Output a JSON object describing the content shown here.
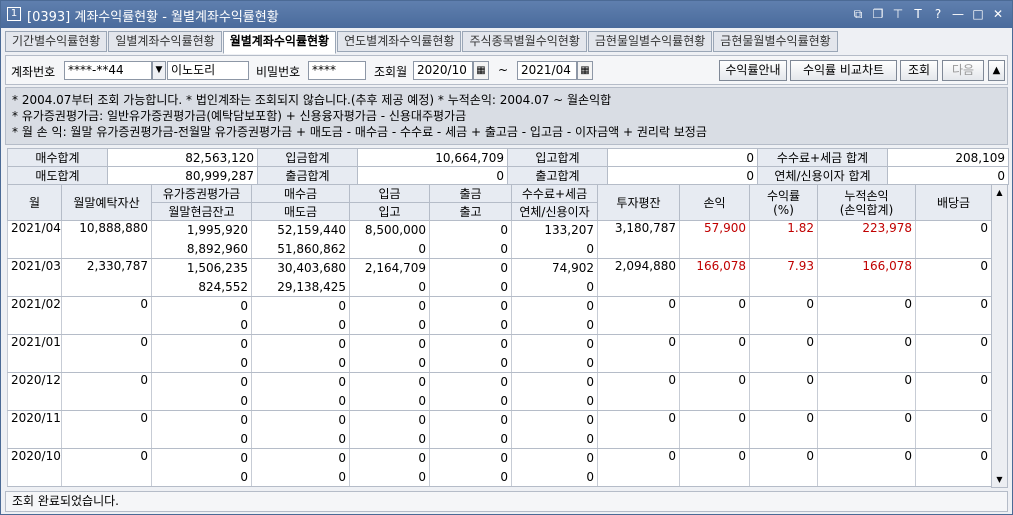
{
  "window": {
    "number": "1",
    "title": "[0393] 계좌수익률현황 - 월별계좌수익률현황"
  },
  "tabs": [
    "기간별수익률현황",
    "일별계좌수익률현황",
    "월별계좌수익률현황",
    "연도별계좌수익률현황",
    "주식종목별월수익현황",
    "금현물일별수익률현황",
    "금현물월별수익률현황"
  ],
  "toolbar": {
    "account_label": "계좌번호",
    "account_value": "****-**44",
    "account_name": "이노도리",
    "password_label": "비밀번호",
    "password_value": "****",
    "period_label": "조회월",
    "from": "2020/10",
    "tilde": "~",
    "to": "2021/04",
    "guide_btn": "수익률안내",
    "compare_btn": "수익률 비교차트",
    "query_btn": "조회",
    "next_btn": "다음",
    "up_btn": "▲"
  },
  "notes": [
    "* 2004.07부터 조회 가능합니다.   * 법인계좌는 조회되지 않습니다.(추후 제공 예정)   * 누적손익: 2004.07 ~ 월손익합",
    "* 유가증권평가금: 일반유가증권평가금(예탁담보포함) + 신용융자평가금 - 신용대주평가금",
    "* 월 손 익: 월말 유가증권평가금-전월말 유가증권평가금 + 매도금 - 매수금 - 수수료 - 세금 + 출고금 - 입고금 - 이자금액 + 권리락 보정금"
  ],
  "summary": {
    "buy_total_label": "매수합계",
    "buy_total": "82,563,120",
    "deposit_total_label": "입금합계",
    "deposit_total": "10,664,709",
    "in_total_label": "입고합계",
    "in_total": "0",
    "fee_total_label": "수수료+세금 합계",
    "fee_total": "208,109",
    "sell_total_label": "매도합계",
    "sell_total": "80,999,287",
    "withdraw_total_label": "출금합계",
    "withdraw_total": "0",
    "out_total_label": "출고합계",
    "out_total": "0",
    "interest_total_label": "연체/신용이자 합계",
    "interest_total": "0"
  },
  "grid": {
    "headers": {
      "month": "월",
      "deposit_assets": "월말예탁자산",
      "securities": "유가증권평가금",
      "cash_balance": "월말현금잔고",
      "buy": "매수금",
      "sell": "매도금",
      "deposit": "입금",
      "in": "입고",
      "withdraw": "출금",
      "out": "출고",
      "fee": "수수료+세금",
      "interest": "연체/신용이자",
      "investment": "투자평잔",
      "pnl": "손익",
      "rate": "수익률\n(%)",
      "cum": "누적손익\n(손익합계)",
      "dividend": "배당금"
    },
    "rows": [
      {
        "month": "2021/04",
        "assets": "10,888,880",
        "sec": "1,995,920",
        "cash": "8,892,960",
        "buy": "52,159,440",
        "sell": "51,860,862",
        "dep": "8,500,000",
        "in": "0",
        "wd": "0",
        "out": "0",
        "fee": "133,207",
        "int": "0",
        "inv": "3,180,787",
        "pnl": "57,900",
        "rate": "1.82",
        "cum": "223,978",
        "div": "0"
      },
      {
        "month": "2021/03",
        "assets": "2,330,787",
        "sec": "1,506,235",
        "cash": "824,552",
        "buy": "30,403,680",
        "sell": "29,138,425",
        "dep": "2,164,709",
        "in": "0",
        "wd": "0",
        "out": "0",
        "fee": "74,902",
        "int": "0",
        "inv": "2,094,880",
        "pnl": "166,078",
        "rate": "7.93",
        "cum": "166,078",
        "div": "0"
      },
      {
        "month": "2021/02",
        "assets": "0",
        "sec": "0",
        "cash": "0",
        "buy": "0",
        "sell": "0",
        "dep": "0",
        "in": "0",
        "wd": "0",
        "out": "0",
        "fee": "0",
        "int": "0",
        "inv": "0",
        "pnl": "0",
        "rate": "0",
        "cum": "0",
        "div": "0"
      },
      {
        "month": "2021/01",
        "assets": "0",
        "sec": "0",
        "cash": "0",
        "buy": "0",
        "sell": "0",
        "dep": "0",
        "in": "0",
        "wd": "0",
        "out": "0",
        "fee": "0",
        "int": "0",
        "inv": "0",
        "pnl": "0",
        "rate": "0",
        "cum": "0",
        "div": "0"
      },
      {
        "month": "2020/12",
        "assets": "0",
        "sec": "0",
        "cash": "0",
        "buy": "0",
        "sell": "0",
        "dep": "0",
        "in": "0",
        "wd": "0",
        "out": "0",
        "fee": "0",
        "int": "0",
        "inv": "0",
        "pnl": "0",
        "rate": "0",
        "cum": "0",
        "div": "0"
      },
      {
        "month": "2020/11",
        "assets": "0",
        "sec": "0",
        "cash": "0",
        "buy": "0",
        "sell": "0",
        "dep": "0",
        "in": "0",
        "wd": "0",
        "out": "0",
        "fee": "0",
        "int": "0",
        "inv": "0",
        "pnl": "0",
        "rate": "0",
        "cum": "0",
        "div": "0"
      },
      {
        "month": "2020/10",
        "assets": "0",
        "sec": "0",
        "cash": "0",
        "buy": "0",
        "sell": "0",
        "dep": "0",
        "in": "0",
        "wd": "0",
        "out": "0",
        "fee": "0",
        "int": "0",
        "inv": "0",
        "pnl": "0",
        "rate": "0",
        "cum": "0",
        "div": "0"
      }
    ]
  },
  "status": "조회 완료되었습니다.",
  "colors": {
    "title_bg": "#4a6b9c",
    "positive": "#c00000"
  }
}
